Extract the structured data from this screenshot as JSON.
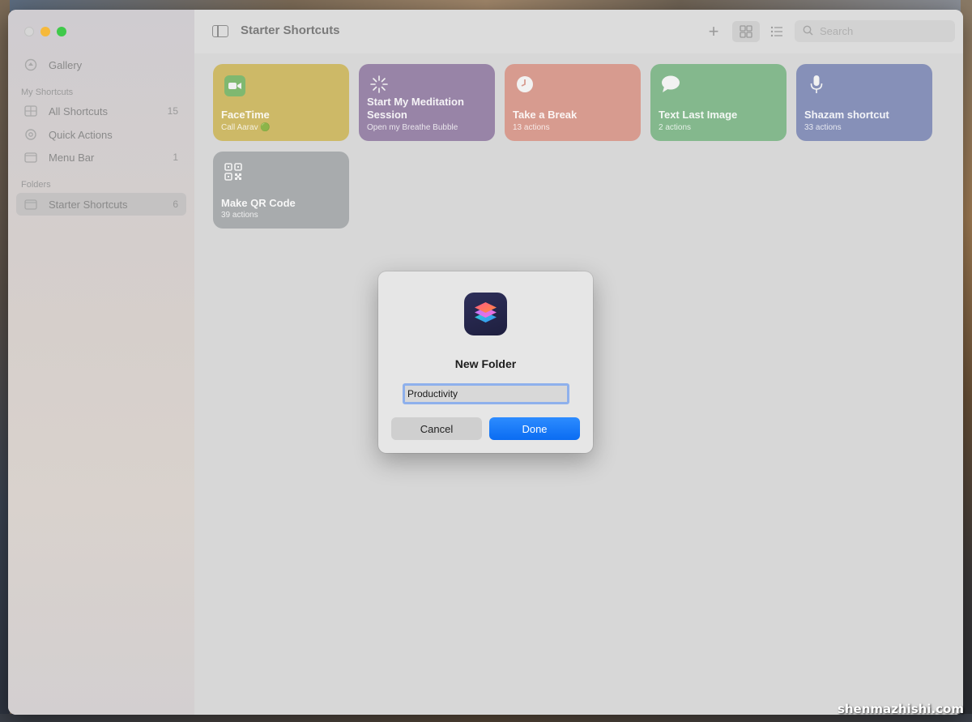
{
  "window": {
    "title": "Starter Shortcuts"
  },
  "sidebar": {
    "gallery": {
      "label": "Gallery",
      "icon": "gallery-icon"
    },
    "my_shortcuts_heading": "My Shortcuts",
    "items": [
      {
        "label": "All Shortcuts",
        "count": "15",
        "icon": "grid-icon"
      },
      {
        "label": "Quick Actions",
        "count": "",
        "icon": "gear-icon"
      },
      {
        "label": "Menu Bar",
        "count": "1",
        "icon": "menubar-icon"
      }
    ],
    "folders_heading": "Folders",
    "folders": [
      {
        "label": "Starter Shortcuts",
        "count": "6",
        "icon": "folder-icon",
        "selected": true
      }
    ]
  },
  "toolbar": {
    "search_placeholder": "Search"
  },
  "shortcuts": [
    {
      "title": "FaceTime",
      "subtitle": "Call Aarav 🟢",
      "color": "#cdb967",
      "icon": "facetime-icon"
    },
    {
      "title": "Start My Meditation Session",
      "subtitle": "Open my Breathe Bubble",
      "color": "#9884a7",
      "icon": "sparkle-icon"
    },
    {
      "title": "Take a Break",
      "subtitle": "13 actions",
      "color": "#d79b8f",
      "icon": "clock-icon"
    },
    {
      "title": "Text Last Image",
      "subtitle": "2 actions",
      "color": "#84b88d",
      "icon": "message-icon"
    },
    {
      "title": "Shazam shortcut",
      "subtitle": "33 actions",
      "color": "#8690b8",
      "icon": "microphone-icon"
    },
    {
      "title": "Make QR Code",
      "subtitle": "39 actions",
      "color": "#a8abad",
      "icon": "qr-code-icon"
    }
  ],
  "dialog": {
    "title": "New Folder",
    "input_value": "Productivity",
    "cancel_label": "Cancel",
    "done_label": "Done",
    "accent": "#0a6cf2"
  },
  "watermark": "shenmazhishi.com"
}
